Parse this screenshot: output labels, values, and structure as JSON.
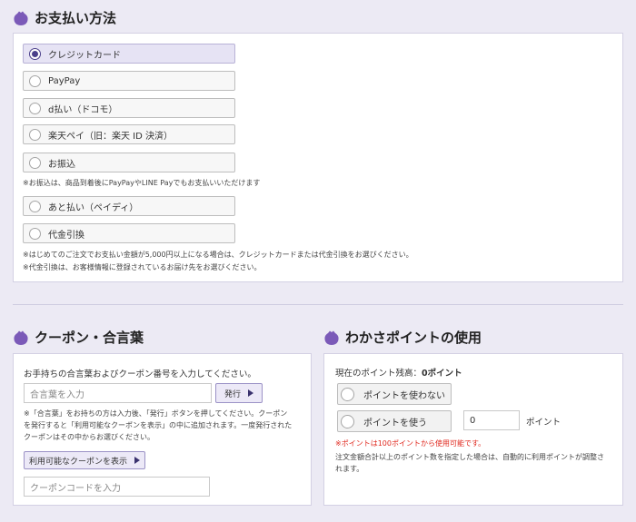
{
  "payment": {
    "title": "お支払い方法",
    "options": [
      {
        "label": "クレジットカード",
        "selected": true
      },
      {
        "label": "PayPay",
        "selected": false
      },
      {
        "label": "d払い（ドコモ）",
        "selected": false
      },
      {
        "label": "楽天ペイ（旧：楽天 ID 決済）",
        "selected": false
      },
      {
        "label": "お振込",
        "selected": false
      },
      {
        "label": "あと払い（ペイディ）",
        "selected": false
      },
      {
        "label": "代金引換",
        "selected": false
      }
    ],
    "furikomi_note": "※お振込は、商品到着後にPayPayやLINE Payでもお支払いいただけます",
    "notes": [
      "※はじめてのご注文でお支払い金額が5,000円以上になる場合は、クレジットカードまたは代金引換をお選びください。",
      "※代金引換は、お客様情報に登録されているお届け先をお選びください。"
    ]
  },
  "coupon": {
    "title": "クーポン・合言葉",
    "intro": "お手持ちの合言葉およびクーポン番号を入力してください。",
    "aikotoba_placeholder": "合言葉を入力",
    "issue_button": "発行",
    "help_lines": [
      "※「合言葉」をお持ちの方は入力後、「発行」ボタンを押してください。クーポン",
      "を発行すると「利用可能なクーポンを表示」の中に追加されます。一度発行された",
      "クーポンはその中からお選びください。"
    ],
    "show_button": "利用可能なクーポンを表示",
    "code_placeholder": "クーポンコードを入力"
  },
  "points": {
    "title": "わかさポイントの使用",
    "balance_label": "現在のポイント残高：",
    "balance_value": "0ポイント",
    "option_no": "ポイントを使わない",
    "option_yes": "ポイントを使う",
    "input_value": "0",
    "unit": "ポイント",
    "warning": "※ポイントは100ポイントから使用可能です。",
    "note_lines": [
      "注文金額合計以上のポイント数を指定した場合は、自動的に利用ポイントが調整さ",
      "れます。"
    ]
  },
  "colors": {
    "accent": "#4a3f8a",
    "icon": "#7b5ab8",
    "background": "#eceaf4",
    "warning": "#e0281e"
  }
}
